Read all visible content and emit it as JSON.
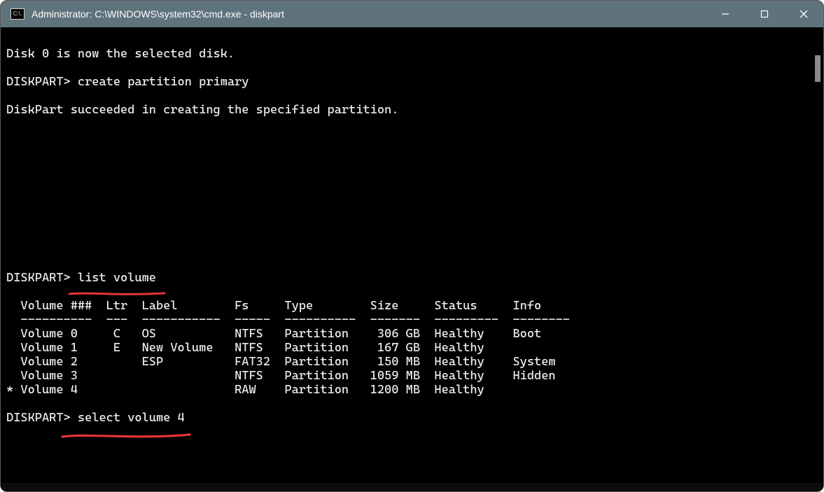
{
  "window": {
    "title": "Administrator: C:\\WINDOWS\\system32\\cmd.exe - diskpart"
  },
  "cmd_icon_text": "C:\\.",
  "lines": {
    "o1": "Disk 0 is now the selected disk.",
    "blank": "",
    "prompt1": "DISKPART> create partition primary",
    "o2": "DiskPart succeeded in creating the specified partition.",
    "prompt2": "DISKPART> list volume",
    "hdr": "  Volume ###  Ltr  Label        Fs     Type        Size     Status     Info",
    "sep": "  ----------  ---  -----------  -----  ----------  -------  ---------  --------",
    "r0": "  Volume 0     C   OS           NTFS   Partition    306 GB  Healthy    Boot",
    "r1": "  Volume 1     E   New Volume   NTFS   Partition    167 GB  Healthy",
    "r2": "  Volume 2         ESP          FAT32  Partition    150 MB  Healthy    System",
    "r3": "  Volume 3                      NTFS   Partition   1059 MB  Healthy    Hidden",
    "r4": "* Volume 4                      RAW    Partition   1200 MB  Healthy",
    "prompt3": "DISKPART> select volume 4"
  }
}
